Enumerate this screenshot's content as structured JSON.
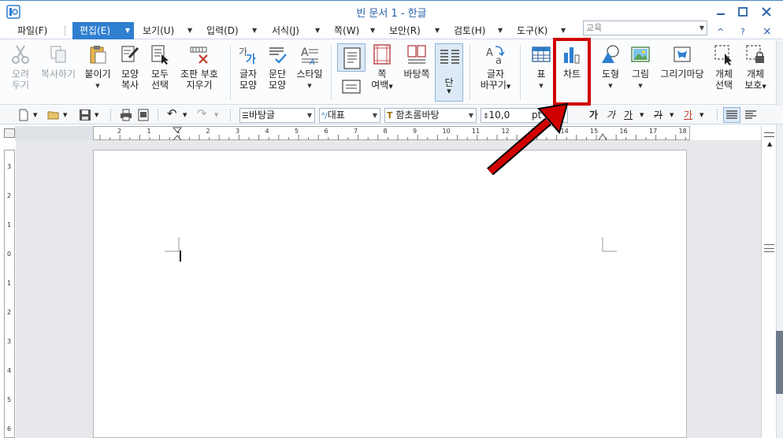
{
  "window": {
    "title": "빈 문서 1 - 한글",
    "app_icon": "hangul-app-icon",
    "controls": [
      "minimize-icon",
      "maximize-icon",
      "close-icon"
    ]
  },
  "menubar": {
    "items": [
      {
        "label": "파일(F)"
      },
      {
        "label": "편집(E)",
        "active": true
      },
      {
        "label": "보기(U)"
      },
      {
        "label": "입력(D)"
      },
      {
        "label": "서식(J)"
      },
      {
        "label": "쪽(W)"
      },
      {
        "label": "보안(R)"
      },
      {
        "label": "검토(H)"
      },
      {
        "label": "도구(K)"
      }
    ],
    "search_placeholder": "교육",
    "extra_controls": [
      "^",
      "?",
      "×"
    ]
  },
  "ribbon": {
    "buttons": [
      {
        "label1": "오려",
        "label2": "두기",
        "icon": "scissors-icon",
        "disabled": true
      },
      {
        "label1": "복사하기",
        "label2": "",
        "icon": "copy-icon",
        "disabled": true
      },
      {
        "label1": "붙이기",
        "label2": "",
        "icon": "paste-icon",
        "dropdown": true
      },
      {
        "label1": "모양",
        "label2": "복사",
        "icon": "format-painter-icon"
      },
      {
        "label1": "모두",
        "label2": "선택",
        "icon": "select-all-icon"
      },
      {
        "label1": "조판 부호",
        "label2": "지우기",
        "icon": "clear-codes-icon"
      },
      {
        "label1": "글자",
        "label2": "모양",
        "icon": "char-shape-icon"
      },
      {
        "label1": "문단",
        "label2": "모양",
        "icon": "para-shape-icon"
      },
      {
        "label1": "스타일",
        "label2": "",
        "icon": "style-icon",
        "dropdown": true
      },
      {
        "label1": "쪽",
        "label2": "여백",
        "icon": "page-margin-icon",
        "dropdown": true
      },
      {
        "label1": "바탕쪽",
        "label2": "",
        "icon": "master-page-icon"
      },
      {
        "label1": "단",
        "label2": "",
        "icon": "columns-icon",
        "dropdown": true
      },
      {
        "label1": "글자",
        "label2": "바꾸기",
        "icon": "replace-char-icon",
        "dropdown": true
      },
      {
        "label1": "표",
        "label2": "",
        "icon": "table-icon",
        "dropdown": true
      },
      {
        "label1": "차트",
        "label2": "",
        "icon": "chart-icon"
      },
      {
        "label1": "도형",
        "label2": "",
        "icon": "shape-icon",
        "dropdown": true
      },
      {
        "label1": "그림",
        "label2": "",
        "icon": "picture-icon",
        "dropdown": true
      },
      {
        "label1": "그리기마당",
        "label2": "",
        "icon": "drawing-gallery-icon"
      },
      {
        "label1": "개체",
        "label2": "선택",
        "icon": "object-select-icon"
      },
      {
        "label1": "개체",
        "label2": "보호",
        "icon": "object-protect-icon",
        "dropdown": true
      }
    ]
  },
  "format_toolbar": {
    "style": "바탕글",
    "language": "대표",
    "font": "함초롬바탕",
    "size": "10,0",
    "size_unit": "pt",
    "glyph_bold": "가",
    "glyph_italic": "가",
    "glyph_underline": "가",
    "glyph_strike": "가",
    "glyph_color": "가"
  },
  "ruler": {
    "labels": [
      "2",
      "1",
      "1",
      "2",
      "3",
      "4",
      "5",
      "6",
      "7",
      "8",
      "9",
      "10",
      "11",
      "12",
      "13",
      "14",
      "15",
      "16",
      "17",
      "18"
    ],
    "v_labels": [
      "3",
      "2",
      "1",
      "0",
      "1",
      "2",
      "3",
      "4",
      "5",
      "6"
    ]
  },
  "annotation": {
    "highlight_color": "#d10000",
    "target": "차트"
  }
}
